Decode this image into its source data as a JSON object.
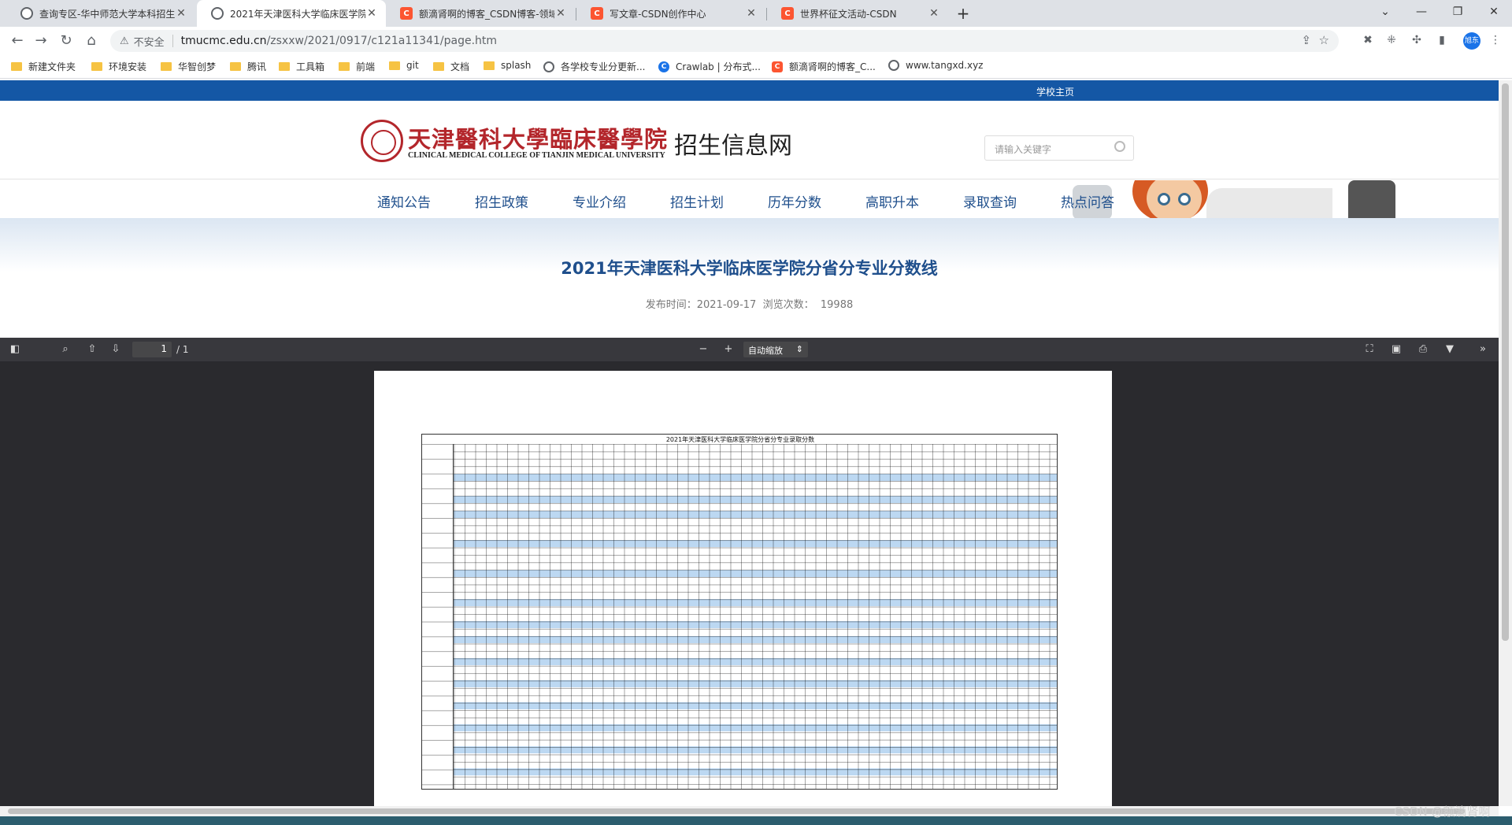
{
  "browser": {
    "tabs": [
      {
        "title": "查询专区-华中师范大学本科招生",
        "icon": "globe-icon",
        "active": false
      },
      {
        "title": "2021年天津医科大学临床医学院",
        "icon": "globe-icon",
        "active": true
      },
      {
        "title": "额滴肾啊的博客_CSDN博客-领域",
        "icon": "csdn-icon",
        "active": false
      },
      {
        "title": "写文章-CSDN创作中心",
        "icon": "csdn-icon",
        "active": false
      },
      {
        "title": "世界杯征文活动-CSDN",
        "icon": "csdn-icon",
        "active": false
      }
    ],
    "address": {
      "security_label": "不安全",
      "domain": "tmucmc.edu.cn",
      "path": "/zsxxw/2021/0917/c121a11341/page.htm"
    },
    "profile_label": "旭东",
    "bookmarks": [
      {
        "label": "新建文件夹",
        "icon": "folder-icon"
      },
      {
        "label": "环境安装",
        "icon": "folder-icon"
      },
      {
        "label": "华智创梦",
        "icon": "folder-icon"
      },
      {
        "label": "腾讯",
        "icon": "folder-icon"
      },
      {
        "label": "工具箱",
        "icon": "folder-icon"
      },
      {
        "label": "前端",
        "icon": "folder-icon"
      },
      {
        "label": "git",
        "icon": "folder-icon"
      },
      {
        "label": "文档",
        "icon": "folder-icon"
      },
      {
        "label": "splash",
        "icon": "folder-icon"
      },
      {
        "label": "各学校专业分更新...",
        "icon": "globe-icon"
      },
      {
        "label": "Crawlab | 分布式...",
        "icon": "crawlab-icon"
      },
      {
        "label": "额滴肾啊的博客_C...",
        "icon": "csdn-icon"
      },
      {
        "label": "www.tangxd.xyz",
        "icon": "globe-icon"
      }
    ]
  },
  "site": {
    "top_link": "学校主页",
    "logo_cn": "天津醫科大學臨床醫學院",
    "logo_en": "CLINICAL MEDICAL COLLEGE OF TIANJIN MEDICAL UNIVERSITY",
    "site_name": "招生信息网",
    "search_placeholder": "请输入关键字",
    "nav": [
      "通知公告",
      "招生政策",
      "专业介绍",
      "招生计划",
      "历年分数",
      "高职升本",
      "录取查询",
      "热点问答"
    ]
  },
  "article": {
    "title": "2021年天津医科大学临床医学院分省分专业分数线",
    "publish_label": "发布时间：",
    "publish_date": "2021-09-17",
    "views_label": "浏览次数：",
    "views": "19988"
  },
  "pdf_viewer": {
    "page_current": "1",
    "page_total": "/ 1",
    "zoom_label": "自动缩放",
    "sheet_title": "2021年天津医科大学临床医学院分省分专业录取分数"
  },
  "watermark": "CSDN @额滴肾啊",
  "colors": {
    "accent": "#1457a5",
    "brand_red": "#b3262b",
    "pdf_toolbar": "#38383d"
  }
}
